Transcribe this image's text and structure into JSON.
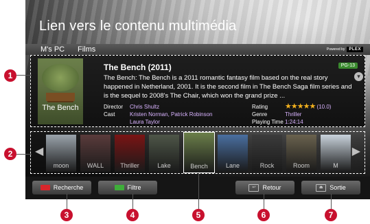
{
  "screen": {
    "title": "Lien vers le contenu multimédia",
    "tabs": [
      "M's PC",
      "Films"
    ],
    "powered_by": "Powered by",
    "plex": "PLEX"
  },
  "movie": {
    "title": "The Bench (2011)",
    "rating_badge": "PG-13",
    "synopsis": "The Bench: The Bench is a 2011 romantic fantasy film based on the real story happened in Netherland, 2001. It is the second film in The Bench Saga film series and is the sequel to 2008's The Chair, which won the grand prize ...",
    "poster_title": "The Bench",
    "director_label": "Director",
    "director": "Chris Shultz",
    "cast_label": "Cast",
    "cast_line1": "Kristen Norman, Patrick Robinson",
    "cast_line2": "Laura Taylor",
    "rating_label": "Rating",
    "stars": 5,
    "score": "(10.0)",
    "genre_label": "Genre",
    "genre": "Thriller",
    "time_label": "Playing Time",
    "time": "1:24:14"
  },
  "thumbnails": [
    {
      "label": "moon",
      "color": "#9aa3ab"
    },
    {
      "label": "WALL",
      "color": "#5a3b3b"
    },
    {
      "label": "Thriller",
      "color": "#7a1414"
    },
    {
      "label": "Lake",
      "color": "#4e5648"
    },
    {
      "label": "Bench",
      "color": "#6b7f4a",
      "selected": true
    },
    {
      "label": "Lane",
      "color": "#4a6fa0"
    },
    {
      "label": "Rock",
      "color": "#3b3b3b"
    },
    {
      "label": "Room",
      "color": "#6a624e"
    },
    {
      "label": "M",
      "color": "#c9d3dc"
    }
  ],
  "buttons": {
    "search": {
      "label": "Recherche",
      "color": "#d7262b"
    },
    "filter": {
      "label": "Filtre",
      "color": "#3fae3a"
    },
    "back": {
      "label": "Retour",
      "icon": "back-key-icon"
    },
    "exit": {
      "label": "Sortie",
      "icon": "exit-key-icon"
    }
  },
  "callouts": [
    "1",
    "2",
    "3",
    "4",
    "5",
    "6",
    "7"
  ]
}
